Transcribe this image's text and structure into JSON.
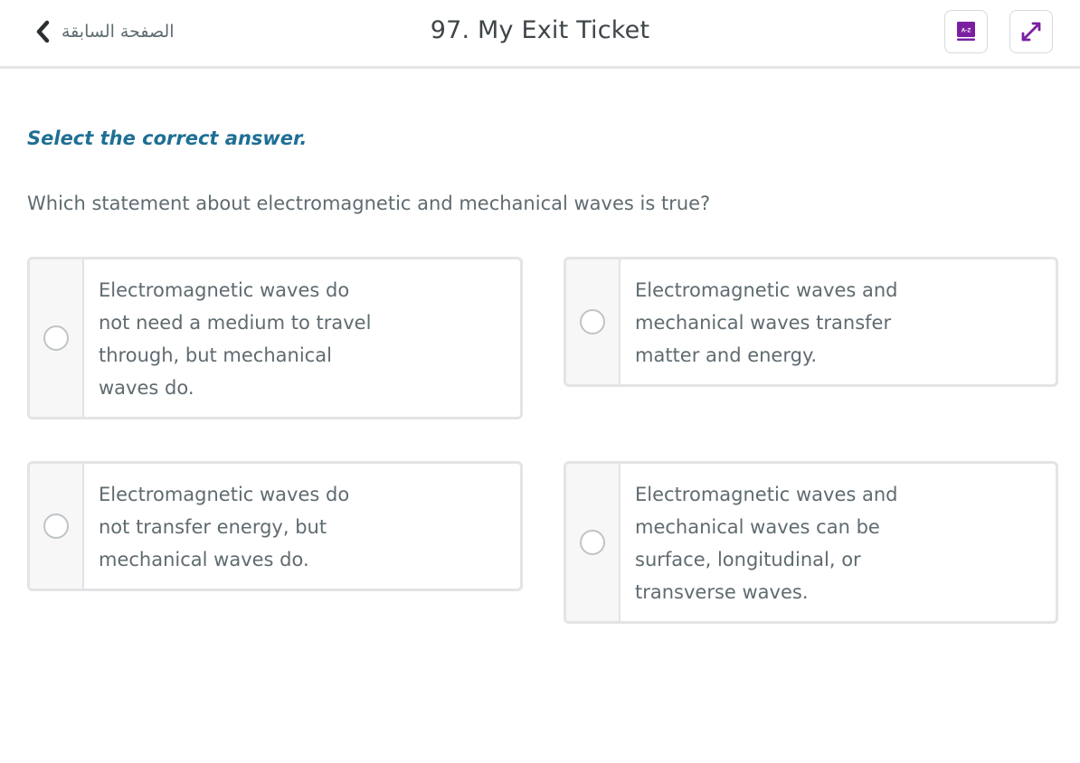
{
  "header": {
    "back_label": "الصفحة السابقة",
    "title": "97. My Exit Ticket",
    "glossary_icon_text": "A-Z",
    "accent_color": "#7b1fa2"
  },
  "question": {
    "instruction": "Select the correct answer.",
    "prompt": "Which statement about electromagnetic and mechanical waves is true?"
  },
  "choices": [
    {
      "text": "Electromagnetic waves do not need a medium to travel through, but mechanical waves do."
    },
    {
      "text": "Electromagnetic waves and mechanical waves transfer matter and energy."
    },
    {
      "text": "Electromagnetic waves do not transfer energy, but mechanical waves do."
    },
    {
      "text": "Electromagnetic waves and mechanical waves can be surface, longitudinal, or transverse waves."
    }
  ]
}
